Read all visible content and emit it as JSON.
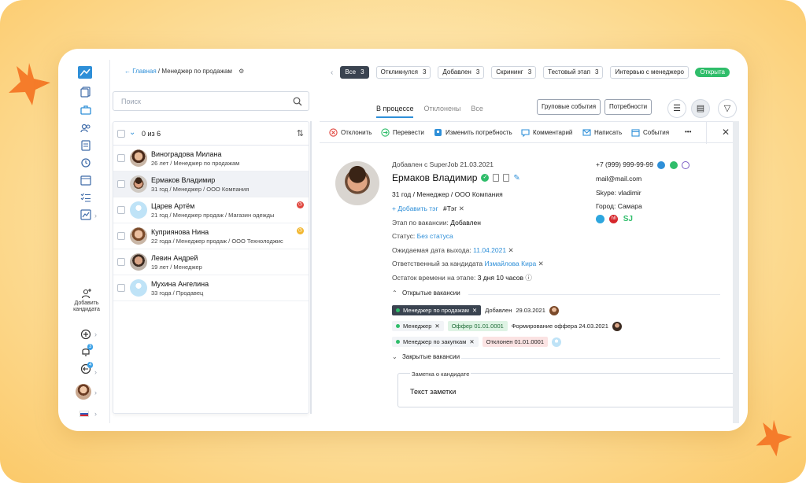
{
  "breadcrumb": {
    "home": "Главная",
    "separator": "/",
    "current": "Менеджер по продажам"
  },
  "stages": [
    {
      "label": "Все",
      "count": "3",
      "active": true
    },
    {
      "label": "Откликнулся",
      "count": "3"
    },
    {
      "label": "Добавлен",
      "count": "3"
    },
    {
      "label": "Скрининг",
      "count": "3"
    },
    {
      "label": "Тестовый этап",
      "count": "3"
    },
    {
      "label": "Интервью с менеджеро",
      "count": ""
    }
  ],
  "vacancy_status": "Открыта",
  "search": {
    "placeholder": "Поиск"
  },
  "filter_tabs": [
    "В процессе",
    "Отклонены",
    "Все"
  ],
  "buttons": {
    "group_events": "Груповые события",
    "needs": "Потребности"
  },
  "list": {
    "selected_count": "0 из 6",
    "candidates": [
      {
        "name": "Виноградова Милана",
        "sub": "26 лет / Менеджер по продажам"
      },
      {
        "name": "Ермаков Владимир",
        "sub": "31 год / Менеджер / ООО Компания"
      },
      {
        "name": "Царев Артём",
        "sub": "21 год / Менеджер продаж / Магазин одежды"
      },
      {
        "name": "Куприянова Нина",
        "sub": "22 года / Менеджер продаж / ООО Технолоджис"
      },
      {
        "name": "Левин Андрей",
        "sub": "19 лет / Менеджер"
      },
      {
        "name": "Мухина Ангелина",
        "sub": "33 года / Продавец"
      }
    ]
  },
  "actions": {
    "reject": "Отклонить",
    "transfer": "Перевести",
    "change_need": "Изменить потребность",
    "comment": "Комментарий",
    "write": "Написать",
    "events": "События",
    "more": "•••"
  },
  "sidebar": {
    "add_candidate": "Добавить кандидата",
    "notif_count": "3",
    "msg_count": "4"
  },
  "candidate": {
    "added": "Добавлен с SuperJob 21.03.2021",
    "name": "Ермаков Владимир",
    "summary": "31 год / Менеджер / ООО Компания",
    "add_tag": "+ Добавить тэг",
    "tag": "#Тэг",
    "stage_label": "Этап по вакансии:",
    "stage_value": "Добавлен",
    "status_label": "Статус:",
    "status_value": "Без статуса",
    "exit_label": "Ожидаемая дата выхода:",
    "exit_value": "11.04.2021",
    "resp_label": "Ответственный за кандидата",
    "resp_value": "Измайлова Кира",
    "time_label": "Остаток времени на этапе:",
    "time_value": "3 дня 10 часов",
    "phone": "+7 (999) 999-99-99",
    "email": "mail@mail.com",
    "skype": "Skype: vladimir",
    "city": "Город: Самара",
    "source_sj": "SJ",
    "source_hh": "hh"
  },
  "vacancies": {
    "open_title": "Открытые вакансии",
    "closed_title": "Закрытые вакансии",
    "rows": [
      {
        "name": "Менеджер по продажам",
        "stage": "Добавлен",
        "date": "29.03.2021"
      },
      {
        "name": "Менеджер",
        "stage": "Оффер",
        "date": "01.01.0001",
        "extra": "Формирование оффера 24.03.2021"
      },
      {
        "name": "Менеджер по закупкам",
        "stage": "Отклонен",
        "date": "01.01.0001"
      }
    ]
  },
  "note": {
    "label": "Заметка о кандидате",
    "text": "Текст заметки"
  },
  "colors": {
    "accent": "#2e8fd8",
    "green": "#2fbd6a",
    "dark": "#3a4350",
    "star": "#f57c2a"
  }
}
